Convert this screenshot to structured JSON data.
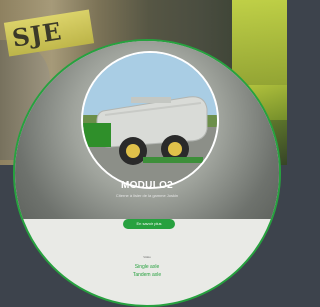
{
  "backdrop": {
    "sign_text": "SJE"
  },
  "card": {
    "product_title": "MODULO2",
    "product_subtitle": "Citerne à lisier de la gamme Joskin",
    "button_label": "En savoir plus",
    "small_label": "Vidéo",
    "link_1": "Single axle",
    "link_2": "Tandem axle"
  },
  "colors": {
    "accent": "#27a13f",
    "background": "#3d434c",
    "tank_body": "#d9dbd7",
    "tractor": "#2f8f2a"
  }
}
